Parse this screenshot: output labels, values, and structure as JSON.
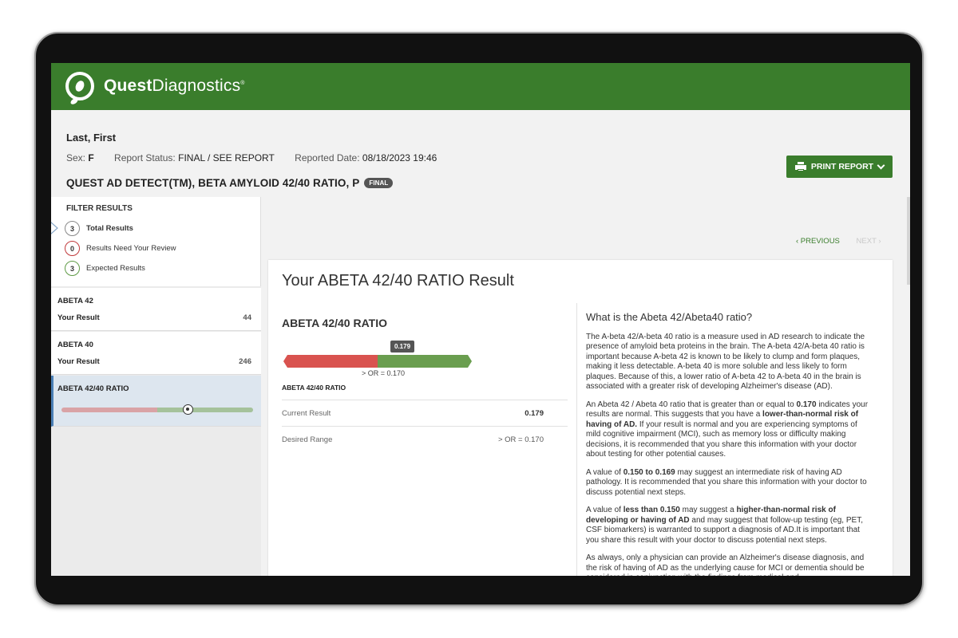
{
  "brand": {
    "name_bold": "Quest",
    "name_light": "Diagnostics",
    "mark": "®",
    "primary_color": "#3a7d2c"
  },
  "patient": {
    "name": "Last, First",
    "sex_label": "Sex:",
    "sex_value": "F",
    "status_label": "Report Status:",
    "status_value": "FINAL / SEE REPORT",
    "reported_label": "Reported Date:",
    "reported_value": "08/18/2023 19:46"
  },
  "test": {
    "title": "QUEST AD DETECT(TM), BETA AMYLOID 42/40 RATIO, P",
    "badge": "FINAL"
  },
  "toolbar": {
    "print_label": "PRINT REPORT",
    "print_icon": "printer-icon",
    "dropdown_icon": "chevron-down-icon"
  },
  "filter": {
    "title": "FILTER RESULTS",
    "items": [
      {
        "count": "3",
        "label": "Total Results"
      },
      {
        "count": "0",
        "label": "Results Need Your Review"
      },
      {
        "count": "3",
        "label": "Expected Results"
      }
    ]
  },
  "results_list": [
    {
      "title": "ABETA 42",
      "your_result_label": "Your Result",
      "value": "44"
    },
    {
      "title": "ABETA 40",
      "your_result_label": "Your Result",
      "value": "246"
    },
    {
      "title": "ABETA 42/40 RATIO",
      "marker_fraction": 0.66
    }
  ],
  "pager": {
    "previous": "‹ PREVIOUS",
    "next": "NEXT ›"
  },
  "result_card": {
    "heading": "Your ABETA 42/40 RATIO Result",
    "analyte": "ABETA 42/40 RATIO",
    "gauge": {
      "value": "0.179",
      "range_text": "> OR = 0.170",
      "label": "ABETA 42/40 RATIO",
      "threshold_fraction": 0.5,
      "low_color": "#d9534f",
      "normal_color": "#6a9e4f"
    },
    "rows": [
      {
        "key": "Current Result",
        "value": "0.179"
      },
      {
        "key": "Desired Range",
        "value": "> OR = 0.170"
      }
    ]
  },
  "info": {
    "heading": "What is the Abeta 42/Abeta40 ratio?",
    "p1": "The A-beta 42/A-beta 40 ratio is a measure used in AD research to indicate the presence of amyloid beta proteins in the brain. The A-beta 42/A-beta 40 ratio is important because A-beta 42 is known to be likely to clump and form plaques, making it less detectable. A-beta 40 is more soluble and less likely to form plaques. Because of this, a lower ratio of A-beta 42 to A-beta 40 in the brain is associated with a greater risk of developing Alzheimer's disease (AD).",
    "p2_a": "An Abeta 42 / Abeta 40 ratio that is greater than or equal to ",
    "p2_b": "0.170",
    "p2_c": " indicates your results are normal. This suggests that you have a ",
    "p2_d": "lower-than-normal risk of having of AD.",
    "p2_e": " If your result is normal and you are experiencing symptoms of mild cognitive impairment (MCI), such as memory loss or difficulty making decisions, it is recommended that you share this information with your doctor about testing for other potential causes.",
    "p3_a": "A value of ",
    "p3_b": "0.150 to 0.169",
    "p3_c": " may suggest an intermediate risk of having AD pathology. It is recommended that you share this information with your doctor to discuss potential next steps.",
    "p4_a": "A value of ",
    "p4_b": "less than 0.150",
    "p4_c": " may suggest a ",
    "p4_d": "higher-than-normal risk of developing or having of AD",
    "p4_e": " and may suggest that follow-up testing (eg, PET, CSF biomarkers) is warranted to support a diagnosis of AD.It is important that you share this result with your doctor to discuss potential next steps.",
    "p5": "As always, only a physician can provide an Alzheimer's disease diagnosis, and the risk of having of AD as the underlying cause for MCI or dementia should be considered in conjunction with the findings from medical and"
  }
}
